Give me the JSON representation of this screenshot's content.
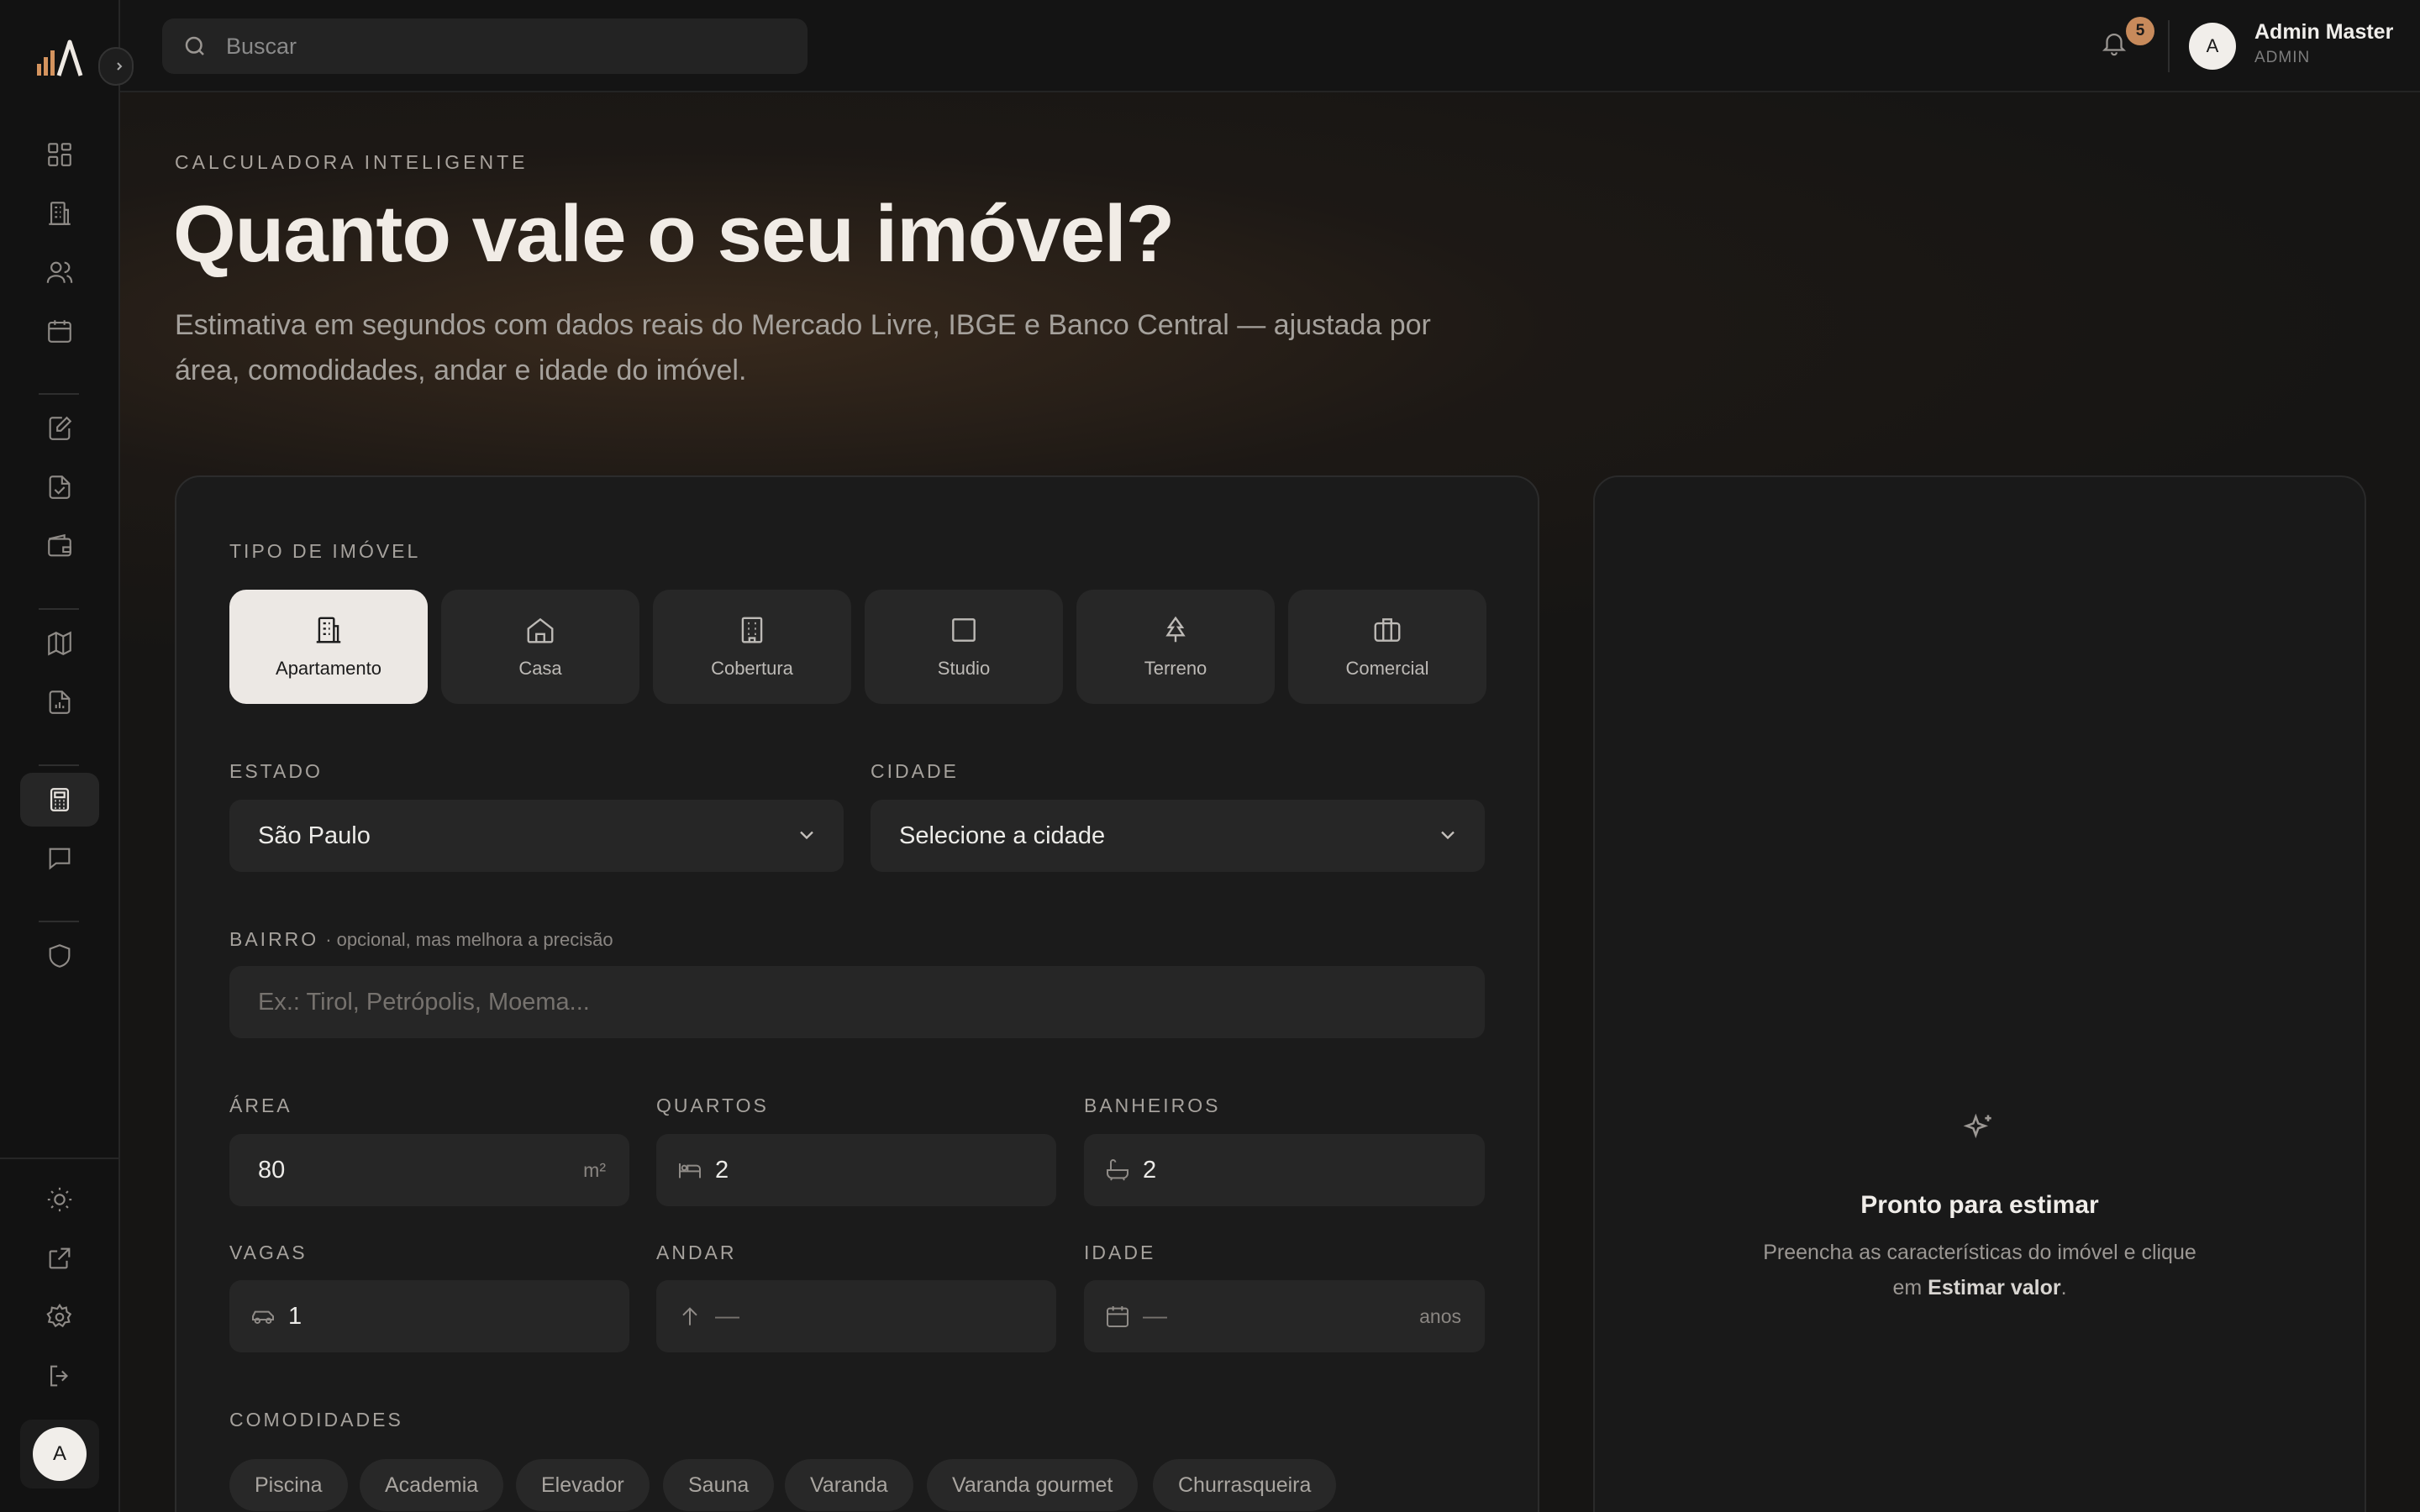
{
  "search": {
    "placeholder": "Buscar"
  },
  "header": {
    "notifications_count": "5",
    "user_initial": "A",
    "user_name": "Admin Master",
    "user_role": "ADMIN"
  },
  "sidebar": {
    "items": [
      {
        "name": "dashboard-icon"
      },
      {
        "name": "building-icon"
      },
      {
        "name": "users-icon"
      },
      {
        "name": "calendar-icon"
      },
      {
        "name": "edit-document-icon"
      },
      {
        "name": "checked-document-icon"
      },
      {
        "name": "wallet-icon"
      },
      {
        "name": "map-icon"
      },
      {
        "name": "report-icon"
      },
      {
        "name": "calculator-icon"
      },
      {
        "name": "chat-icon"
      },
      {
        "name": "shield-icon"
      }
    ],
    "bottom": [
      "sun-icon",
      "external-link-icon",
      "gear-icon",
      "logout-icon"
    ],
    "avatar_initial": "A"
  },
  "hero": {
    "eyebrow": "CALCULADORA INTELIGENTE",
    "title": "Quanto vale o seu imóvel?",
    "subtitle": "Estimativa em segundos com dados reais do Mercado Livre, IBGE e Banco Central — ajustada por área, comodidades, andar e idade do imóvel."
  },
  "form": {
    "type_label": "TIPO DE IMÓVEL",
    "types": [
      {
        "label": "Apartamento",
        "active": true
      },
      {
        "label": "Casa"
      },
      {
        "label": "Cobertura"
      },
      {
        "label": "Studio"
      },
      {
        "label": "Terreno"
      },
      {
        "label": "Comercial"
      }
    ],
    "state_label": "ESTADO",
    "state_value": "São Paulo",
    "city_label": "CIDADE",
    "city_value": "Selecione a cidade",
    "neighborhood_label": "BAIRRO",
    "neighborhood_hint": "· opcional, mas melhora a precisão",
    "neighborhood_placeholder": "Ex.: Tirol, Petrópolis, Moema...",
    "area_label": "ÁREA",
    "area_value": "80",
    "area_unit": "m²",
    "rooms_label": "QUARTOS",
    "rooms_value": "2",
    "baths_label": "BANHEIROS",
    "baths_value": "2",
    "parking_label": "VAGAS",
    "parking_value": "1",
    "floor_label": "ANDAR",
    "floor_value": "—",
    "age_label": "IDADE",
    "age_value": "—",
    "age_unit": "anos",
    "amenities_label": "COMODIDADES",
    "amenities": [
      "Piscina",
      "Academia",
      "Elevador",
      "Sauna",
      "Varanda",
      "Varanda gourmet",
      "Churrasqueira"
    ]
  },
  "result": {
    "title": "Pronto para estimar",
    "text_before": "Preencha as características do imóvel e clique em ",
    "text_bold": "Estimar valor",
    "text_after": "."
  }
}
